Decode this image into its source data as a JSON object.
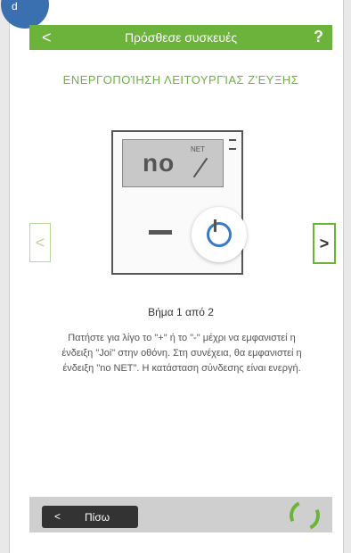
{
  "header": {
    "back_glyph": "<",
    "title": "Πρόσθεσε συσκευές",
    "help": "?"
  },
  "section": {
    "title": "ΕΝΕΡΓΟΠΟΊΗΣΗ ΛΕΙΤΟΥΡΓΊΑΣ Ζ'ΕΥΞΗΣ"
  },
  "nav": {
    "prev": "<",
    "next": ">"
  },
  "device": {
    "display_text": "no",
    "display_small": "NET"
  },
  "step": "Βήμα 1 από 2",
  "description": "Πατήστε για λίγο το \"+\" ή το \"-\" μέχρι να εμφανιστεί η ένδειξη \"Joi\" στην οθόνη. Στη συνέχεια, θα εμφανιστεί η ένδειξη \"no NET\". Η κατάσταση σύνδεσης είναι ενεργή.",
  "footer": {
    "back_label": "Πίσω",
    "back_glyph": "<"
  },
  "colors": {
    "accent": "#6bb33b",
    "badge": "#3a6fb0"
  },
  "icons": {
    "corner": "d"
  }
}
